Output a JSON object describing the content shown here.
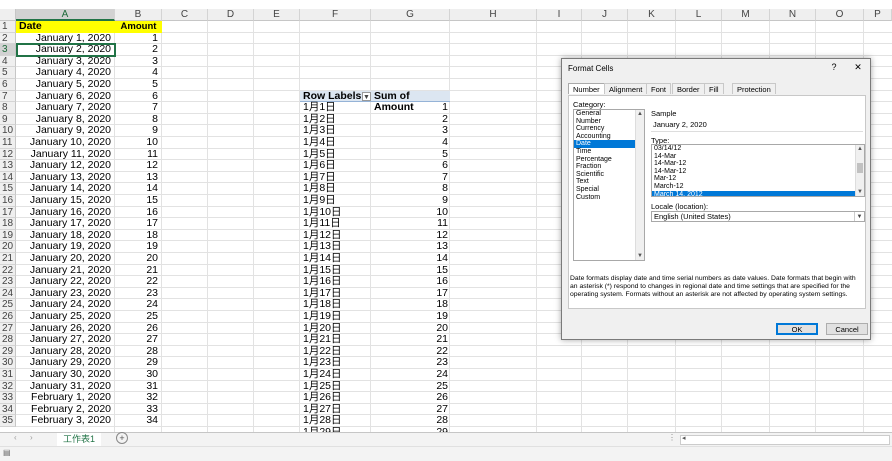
{
  "columns": [
    "A",
    "B",
    "C",
    "D",
    "E",
    "F",
    "G",
    "H",
    "I",
    "J",
    "K",
    "L",
    "M",
    "N",
    "O",
    "P"
  ],
  "selected_column": "A",
  "selected_row": 3,
  "rows": [
    1,
    2,
    3,
    4,
    5,
    6,
    7,
    8,
    9,
    10,
    11,
    12,
    13,
    14,
    15,
    16,
    17,
    18,
    19,
    20,
    21,
    22,
    23,
    24,
    25,
    26,
    27,
    28,
    29,
    30,
    31,
    32,
    33,
    34,
    35
  ],
  "table_header": {
    "date": "Date",
    "amount": "Amount"
  },
  "dates": [
    "January 1, 2020",
    "January 2, 2020",
    "January 3, 2020",
    "January 4, 2020",
    "January 5, 2020",
    "January 6, 2020",
    "January 7, 2020",
    "January 8, 2020",
    "January 9, 2020",
    "January 10, 2020",
    "January 11, 2020",
    "January 12, 2020",
    "January 13, 2020",
    "January 14, 2020",
    "January 15, 2020",
    "January 16, 2020",
    "January 17, 2020",
    "January 18, 2020",
    "January 19, 2020",
    "January 20, 2020",
    "January 21, 2020",
    "January 22, 2020",
    "January 23, 2020",
    "January 24, 2020",
    "January 25, 2020",
    "January 26, 2020",
    "January 27, 2020",
    "January 28, 2020",
    "January 29, 2020",
    "January 30, 2020",
    "January 31, 2020",
    "February 1, 2020",
    "February 2, 2020",
    "February 3, 2020"
  ],
  "amounts": [
    "1",
    "2",
    "3",
    "4",
    "5",
    "6",
    "7",
    "8",
    "9",
    "10",
    "11",
    "12",
    "13",
    "14",
    "15",
    "16",
    "17",
    "18",
    "19",
    "20",
    "21",
    "22",
    "23",
    "24",
    "25",
    "26",
    "27",
    "28",
    "29",
    "30",
    "31",
    "32",
    "33",
    "34"
  ],
  "pivot": {
    "row_labels": "Row Labels",
    "sum_header": "Sum of Amount",
    "labels": [
      "1月1日",
      "1月2日",
      "1月3日",
      "1月4日",
      "1月5日",
      "1月6日",
      "1月7日",
      "1月8日",
      "1月9日",
      "1月10日",
      "1月11日",
      "1月12日",
      "1月13日",
      "1月14日",
      "1月15日",
      "1月16日",
      "1月17日",
      "1月18日",
      "1月19日",
      "1月20日",
      "1月21日",
      "1月22日",
      "1月23日",
      "1月24日",
      "1月25日",
      "1月26日",
      "1月27日",
      "1月28日",
      "1月29日"
    ],
    "values": [
      "1",
      "2",
      "3",
      "4",
      "5",
      "6",
      "7",
      "8",
      "9",
      "10",
      "11",
      "12",
      "13",
      "14",
      "15",
      "16",
      "17",
      "18",
      "19",
      "20",
      "21",
      "22",
      "23",
      "24",
      "25",
      "26",
      "27",
      "28",
      "29"
    ]
  },
  "sheet_tab": "工作表1",
  "dialog": {
    "title": "Format Cells",
    "help": "?",
    "close": "✕",
    "tabs": [
      "Number",
      "Alignment",
      "Font",
      "Border",
      "Fill",
      "Protection"
    ],
    "category_label": "Category:",
    "categories": [
      "General",
      "Number",
      "Currency",
      "Accounting",
      "Date",
      "Time",
      "Percentage",
      "Fraction",
      "Scientific",
      "Text",
      "Special",
      "Custom"
    ],
    "selected_category": "Date",
    "sample_label": "Sample",
    "sample_value": "January 2, 2020",
    "type_label": "Type:",
    "types": [
      "03/14/12",
      "14-Mar",
      "14-Mar-12",
      "14-Mar-12",
      "Mar-12",
      "March-12",
      "March 14, 2012"
    ],
    "selected_type": "March 14, 2012",
    "locale_label": "Locale (location):",
    "locale_value": "English (United States)",
    "description": "Date formats display date and time serial numbers as date values.  Date formats that begin with an asterisk (*) respond to changes in regional date and time settings that are specified for the operating system. Formats without an asterisk are not affected by operating system settings.",
    "ok": "OK",
    "cancel": "Cancel"
  },
  "colors": {
    "accent": "#217346",
    "header_fill": "#ffff00",
    "pivot_fill": "#dce6f1",
    "selection": "#0078d7"
  }
}
